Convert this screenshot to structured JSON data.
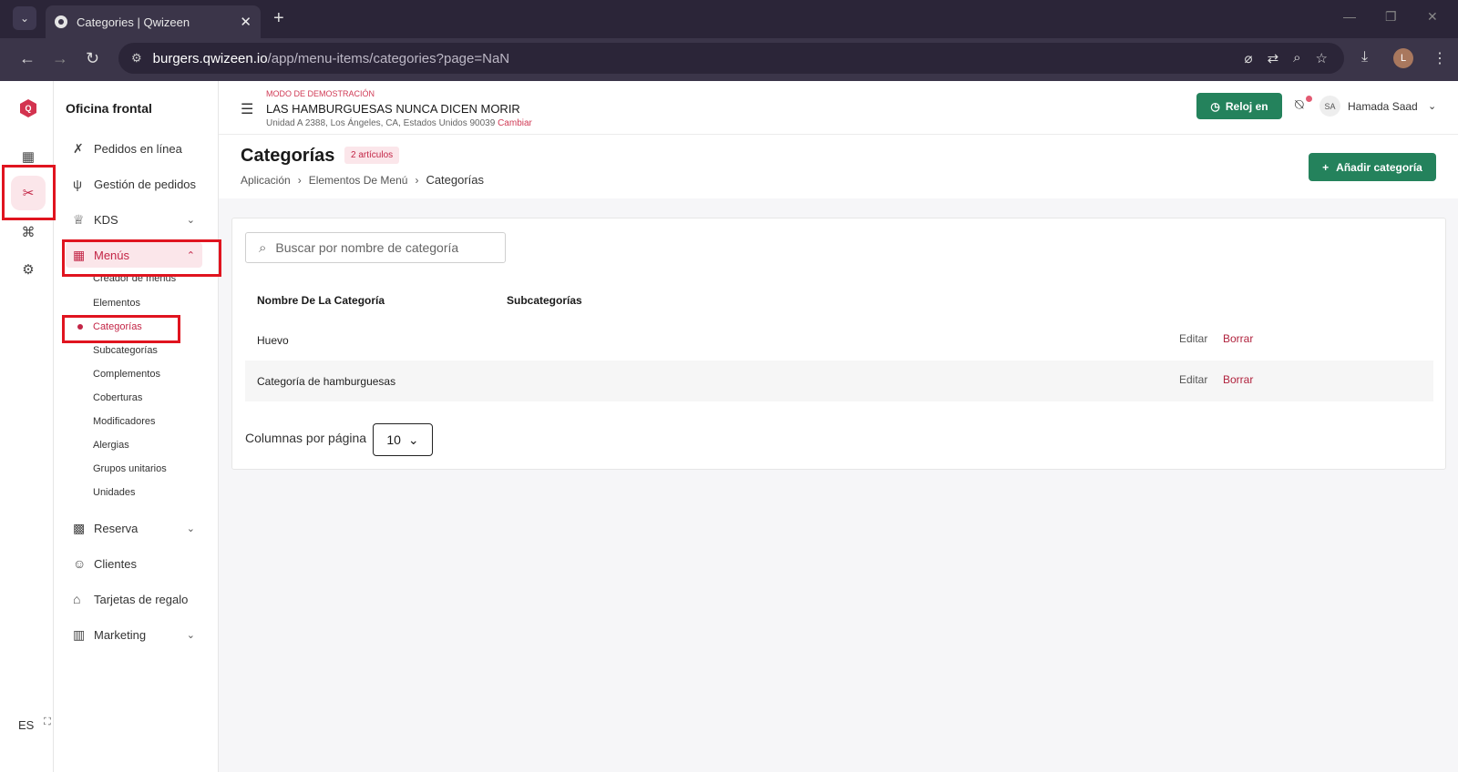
{
  "browser": {
    "tab_title": "Categories | Qwizeen",
    "url_host": "burgers.qwizeen.io",
    "url_path": "/app/menu-items/categories?page=NaN",
    "profile_initial": "L"
  },
  "rail": {
    "logo": "Q",
    "language": "ES"
  },
  "sidebar": {
    "title": "Oficina frontal",
    "items": [
      {
        "label": "Pedidos en línea",
        "icon": "fork-knife-icon"
      },
      {
        "label": "Gestión de pedidos",
        "icon": "utensils-icon"
      },
      {
        "label": "KDS",
        "icon": "chef-hat-icon"
      },
      {
        "label": "Menús",
        "icon": "grid-icon"
      },
      {
        "label": "Reserva",
        "icon": "calendar-icon"
      },
      {
        "label": "Clientes",
        "icon": "users-icon"
      },
      {
        "label": "Tarjetas de regalo",
        "icon": "gift-icon"
      },
      {
        "label": "Marketing",
        "icon": "bar-chart-icon"
      }
    ],
    "menus_sub": [
      "Creador de menús",
      "Elementos",
      "Categorías",
      "Subcategorías",
      "Complementos",
      "Coberturas",
      "Modificadores",
      "Alergias",
      "Grupos unitarios",
      "Unidades"
    ]
  },
  "topbar": {
    "demo_label": "MODO DE DEMOSTRACIÓN",
    "restaurant": "LAS HAMBURGUESAS NUNCA DICEN MORIR",
    "address": "Unidad A 2388, Los Ángeles, CA, Estados Unidos 90039",
    "change": "Cambiar",
    "clock_in": "Reloj en",
    "user_initials": "SA",
    "user_name": "Hamada Saad"
  },
  "page": {
    "title": "Categorías",
    "count_badge": "2 artículos",
    "breadcrumb": [
      "Aplicación",
      "Elementos De Menú",
      "Categorías"
    ],
    "add_button": "Añadir categoría"
  },
  "table": {
    "search_placeholder": "Buscar por nombre de categoría",
    "columns": [
      "Nombre De La Categoría",
      "Subcategorías"
    ],
    "rows": [
      {
        "name": "Huevo",
        "edit": "Editar",
        "delete": "Borrar"
      },
      {
        "name": "Categoría de hamburguesas",
        "edit": "Editar",
        "delete": "Borrar"
      }
    ],
    "per_page_label": "Columnas por página",
    "per_page_value": "10"
  },
  "colors": {
    "accent": "#c32546",
    "primary_button": "#24825c",
    "highlight_box": "#e0141f"
  }
}
